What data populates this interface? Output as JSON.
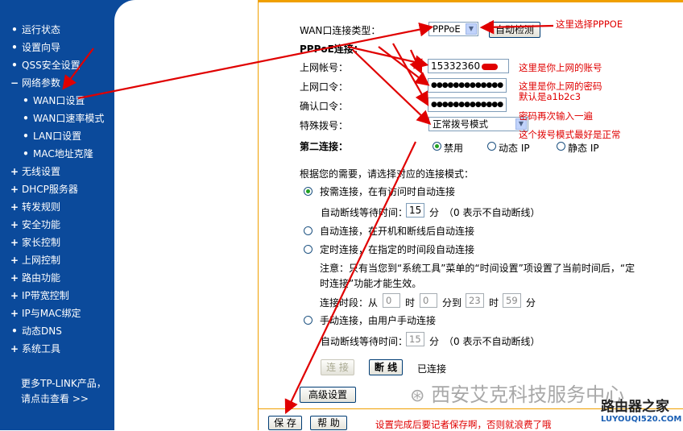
{
  "sidebar": {
    "items": [
      {
        "mark": "•",
        "label": "运行状态"
      },
      {
        "mark": "•",
        "label": "设置向导"
      },
      {
        "mark": "•",
        "label": "QSS安全设置"
      },
      {
        "mark": "−",
        "label": "网络参数"
      },
      {
        "mark": "•",
        "label": "WAN口设置"
      },
      {
        "mark": "•",
        "label": "WAN口速率模式"
      },
      {
        "mark": "•",
        "label": "LAN口设置"
      },
      {
        "mark": "•",
        "label": "MAC地址克隆"
      },
      {
        "mark": "+",
        "label": "无线设置"
      },
      {
        "mark": "+",
        "label": "DHCP服务器"
      },
      {
        "mark": "+",
        "label": "转发规则"
      },
      {
        "mark": "+",
        "label": "安全功能"
      },
      {
        "mark": "+",
        "label": "家长控制"
      },
      {
        "mark": "+",
        "label": "上网控制"
      },
      {
        "mark": "+",
        "label": "路由功能"
      },
      {
        "mark": "+",
        "label": "IP带宽控制"
      },
      {
        "mark": "+",
        "label": "IP与MAC绑定"
      },
      {
        "mark": "•",
        "label": "动态DNS"
      },
      {
        "mark": "+",
        "label": "系统工具"
      }
    ],
    "more_line1": "更多TP-LINK产品，",
    "more_line2": "请点击查看 >>"
  },
  "form": {
    "wan_type_label": "WAN口连接类型：",
    "wan_type_value": "PPPoE",
    "auto_detect_button": "自动检测",
    "pppoe_title": "PPPoE连接：",
    "username_label": "上网帐号：",
    "username_value": "15332360",
    "password_label": "上网口令：",
    "password_value": "●●●●●●●●●●●●●",
    "confirm_label": "确认口令：",
    "confirm_value": "●●●●●●●●●●●●●",
    "dial_label": "特殊拨号：",
    "dial_value": "正常拨号模式",
    "second_conn_label": "第二连接：",
    "second_conn_options": [
      "禁用",
      "动态 IP",
      "静态 IP"
    ],
    "mode_prompt": "根据您的需要，请选择对应的连接模式：",
    "mode_on_demand": "按需连接，在有访问时自动连接",
    "idle_label": "自动断线等待时间：",
    "idle_value": "15",
    "idle_unit": "分",
    "idle_hint": "（0 表示不自动断线）",
    "mode_auto": "自动连接，在开机和断线后自动连接",
    "mode_timed": "定时连接，在指定的时间段自动连接",
    "note_line1": "注意：只有当您到“系统工具”菜单的“时间设置”项设置了当前时间后，“定",
    "note_line2": "时连接”功能才能生效。",
    "period_label": "连接时段：从",
    "period_from_h": "0",
    "period_hour": "时",
    "period_from_m": "0",
    "period_to": "分到",
    "period_to_h": "23",
    "period_hour2": "时",
    "period_to_m": "59",
    "period_min": "分",
    "mode_manual": "手动连接，由用户手动连接",
    "idle2_label": "自动断线等待时间：",
    "idle2_value": "15",
    "idle2_unit": "分",
    "idle2_hint": "（0 表示不自动断线）",
    "connect_button": "连 接",
    "disconnect_button": "断 线",
    "status_text": "已连接",
    "advanced_button": "高级设置",
    "save_button": "保 存",
    "help_button": "帮 助"
  },
  "annotations": {
    "choose_pppoe": "这里选择PPPOE",
    "account_note": "这里是你上网的账号",
    "password_note1": "这里是你上网的密码",
    "password_note2": "默认是a1b2c3",
    "confirm_note": "密码再次输入一遍",
    "dial_note": "这个拨号模式最好是正常",
    "save_note": "设置完成后要记者保存啊，否则就浪费了哦"
  },
  "watermark": "西安艾克科技服务中心",
  "brand": {
    "name": "路由器之家",
    "url": "LUYOUQI520.COM"
  },
  "colors": {
    "sidebar_bg": "#0b4a9b",
    "accent_border": "#f0a000",
    "annotation_red": "#e00000"
  }
}
